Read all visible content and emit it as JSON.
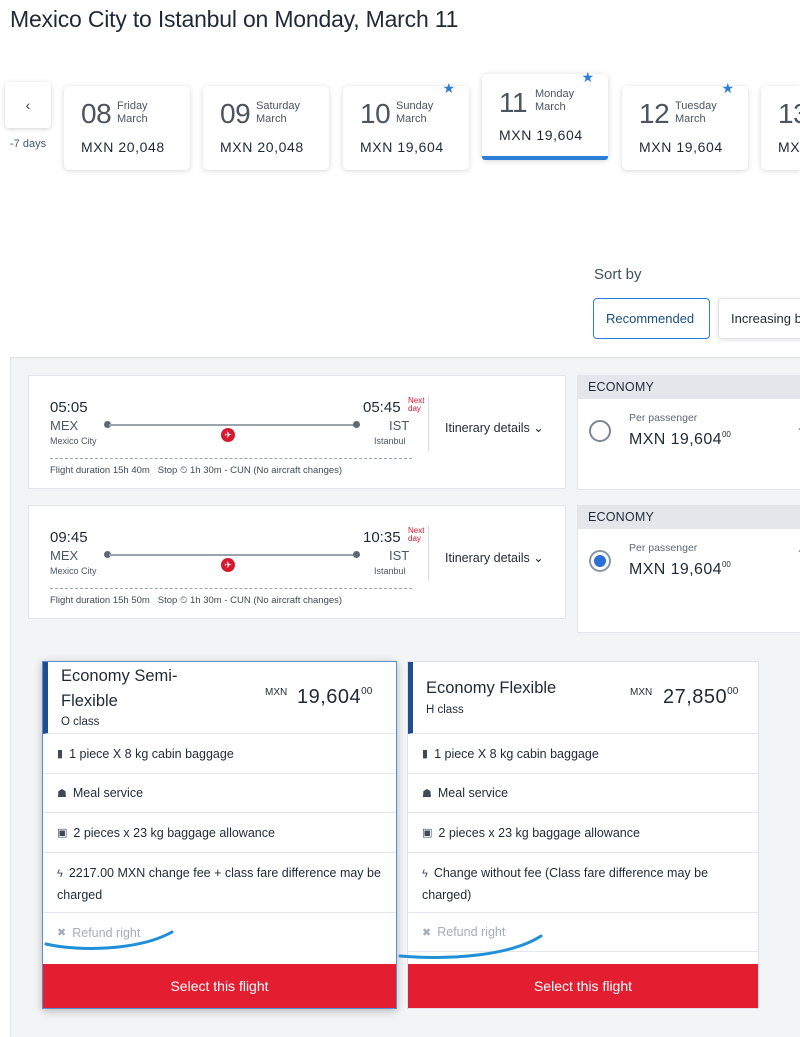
{
  "header": {
    "title": "Mexico City to Istanbul on Monday, March 11"
  },
  "date_nav": {
    "prev_arrow": "‹",
    "prev_label": "-7 days",
    "days": [
      {
        "num": "08",
        "weekday": "Friday",
        "month": "March",
        "price": "MXN 20,048",
        "star": false,
        "active": false
      },
      {
        "num": "09",
        "weekday": "Saturday",
        "month": "March",
        "price": "MXN 20,048",
        "star": false,
        "active": false
      },
      {
        "num": "10",
        "weekday": "Sunday",
        "month": "March",
        "price": "MXN 19,604",
        "star": true,
        "active": false
      },
      {
        "num": "11",
        "weekday": "Monday",
        "month": "March",
        "price": "MXN 19,604",
        "star": true,
        "active": true
      },
      {
        "num": "12",
        "weekday": "Tuesday",
        "month": "March",
        "price": "MXN 19,604",
        "star": true,
        "active": false
      },
      {
        "num": "13",
        "weekday": "",
        "month": "",
        "price": "MX",
        "star": false,
        "active": false
      }
    ]
  },
  "sort": {
    "label": "Sort by",
    "options": [
      "Recommended",
      "Increasing b"
    ]
  },
  "flights": [
    {
      "depart_time": "05:05",
      "depart_code": "MEX",
      "depart_city": "Mexico City",
      "arrive_time": "05:45",
      "arrive_code": "IST",
      "arrive_city": "Istanbul",
      "next_day_1": "Next",
      "next_day_2": "day",
      "duration_label": "Flight duration",
      "duration": "15h 40m",
      "stop_label": "Stop",
      "stop_detail": "1h 30m - CUN",
      "note": "(No aircraft changes)",
      "itinerary": "Itinerary details",
      "cabin": "ECONOMY",
      "per_passenger": "Per passenger",
      "price": "MXN 19,604",
      "cents": "00",
      "selected": false
    },
    {
      "depart_time": "09:45",
      "depart_code": "MEX",
      "depart_city": "Mexico City",
      "arrive_time": "10:35",
      "arrive_code": "IST",
      "arrive_city": "Istanbul",
      "next_day_1": "Next",
      "next_day_2": "day",
      "duration_label": "Flight duration",
      "duration": "15h 50m",
      "stop_label": "Stop",
      "stop_detail": "1h 30m - CUN",
      "note": "(No aircraft changes)",
      "itinerary": "Itinerary details",
      "cabin": "ECONOMY",
      "per_passenger": "Per passenger",
      "price": "MXN 19,604",
      "cents": "00",
      "selected": true
    }
  ],
  "fares": [
    {
      "name_line1": "Economy Semi-",
      "name_line2": "Flexible",
      "class": "O class",
      "currency": "MXN",
      "amount": "19,604",
      "cents": "00",
      "features": [
        "1 piece X 8 kg cabin baggage",
        "Meal service",
        "2 pieces x 23 kg baggage allowance",
        "2217.00 MXN change fee + class fare difference may be charged",
        "Refund right"
      ],
      "button": "Select this flight"
    },
    {
      "name_line1": "Economy Flexible",
      "class": "H class",
      "currency": "MXN",
      "amount": "27,850",
      "cents": "00",
      "features": [
        "1 piece X 8 kg cabin baggage",
        "Meal service",
        "2 pieces x 23 kg baggage allowance",
        "Change without fee (Class fare difference may be charged)",
        "Refund right"
      ],
      "button": "Select this flight"
    }
  ],
  "icons": {
    "cabin_bag": "🧳",
    "meal": "🍽",
    "checked_bag": "🧳",
    "change": "⚡",
    "refund": "✖",
    "chevron": "⌄",
    "star": "★",
    "clock": "⏲"
  },
  "colors": {
    "accent": "#2c7fd6",
    "brand_red": "#e41e31",
    "dark_blue": "#1d4f8c",
    "annotation": "#1f8fd8"
  }
}
